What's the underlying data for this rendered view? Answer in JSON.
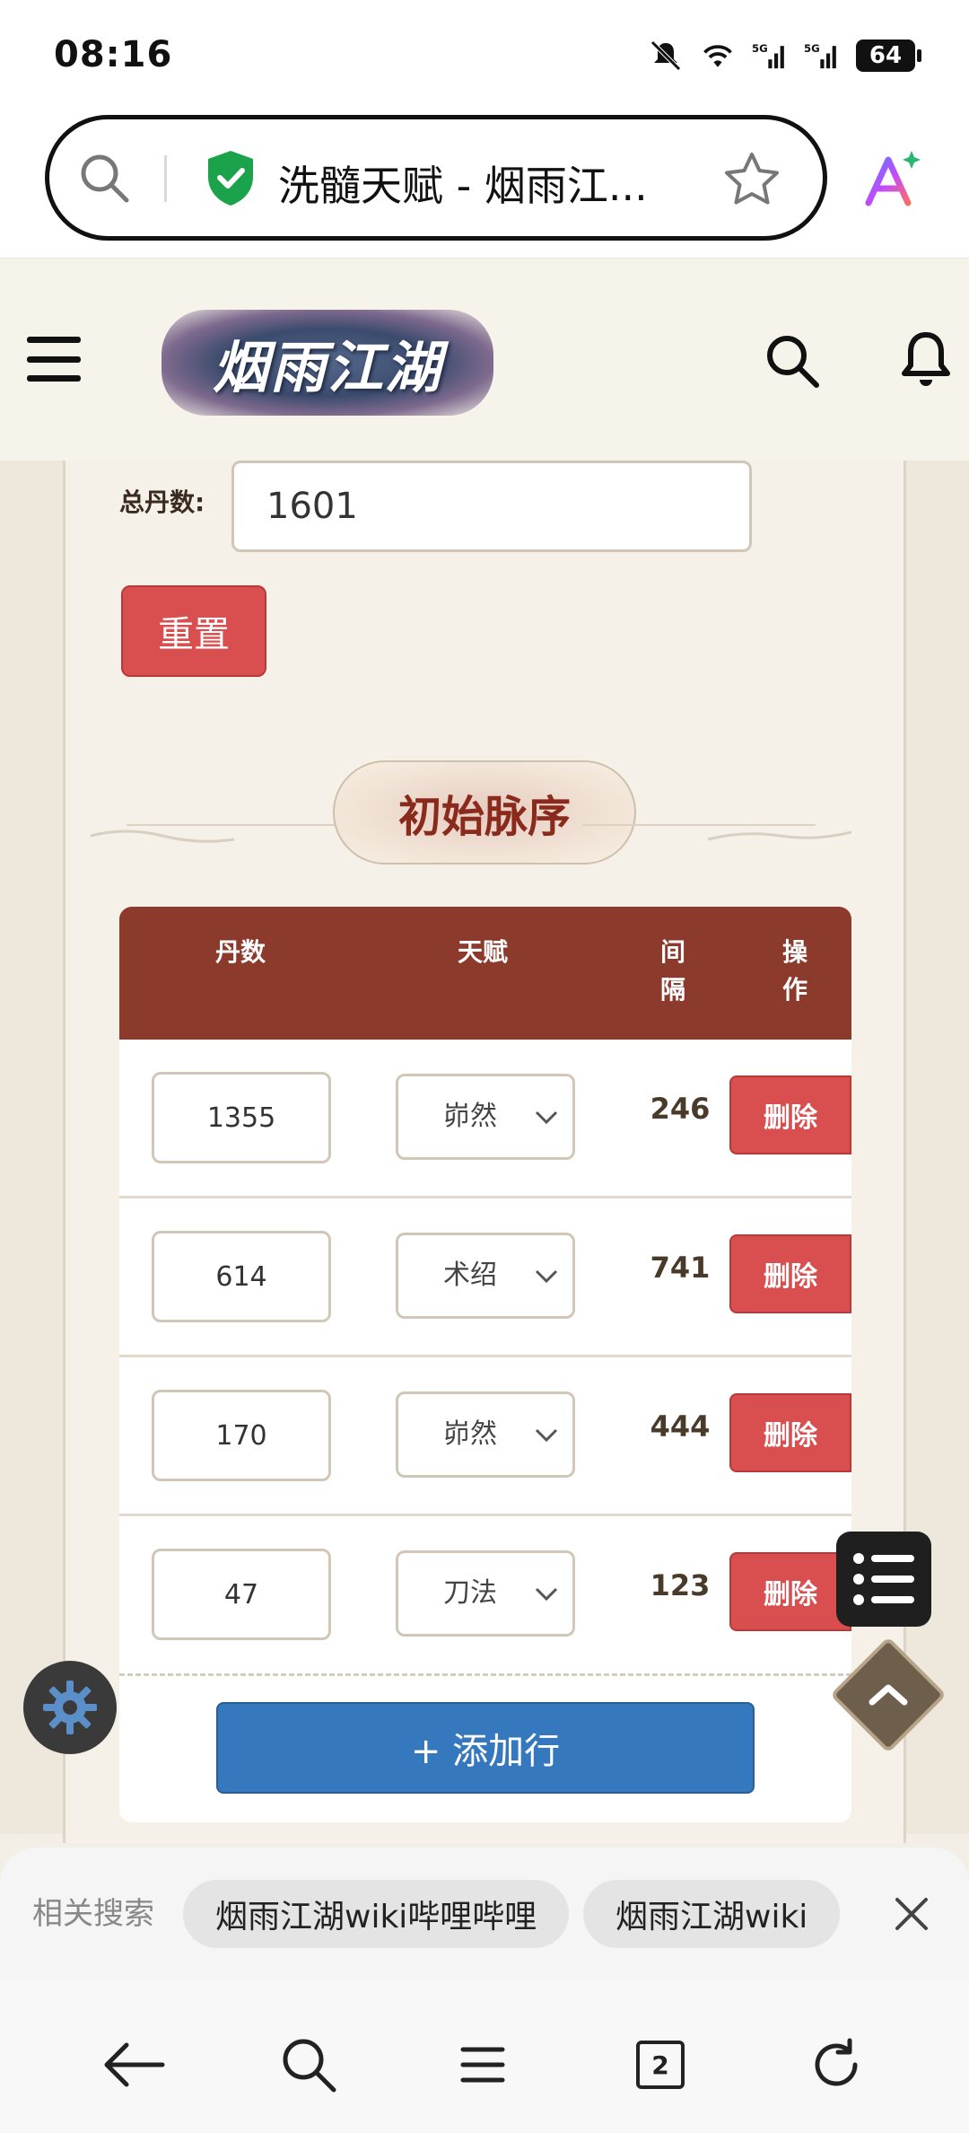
{
  "status_bar": {
    "time": "08:16",
    "battery": "64",
    "signal1": "5G",
    "signal2": "5G"
  },
  "browser": {
    "tab_title": "洗髓天赋 - 烟雨江..."
  },
  "site": {
    "logo_text": "烟雨江湖"
  },
  "form": {
    "total_label": "总丹数:",
    "total_value": "1601",
    "reset_label": "重置"
  },
  "section": {
    "title": "初始脉序"
  },
  "table": {
    "headers": {
      "dan": "丹数",
      "talent": "天赋",
      "gap_line1": "间",
      "gap_line2": "隔",
      "op_line1": "操",
      "op_line2": "作"
    },
    "rows": [
      {
        "dan": "1355",
        "talent": "峁然",
        "gap": "246",
        "delete": "删除"
      },
      {
        "dan": "614",
        "talent": "术绍",
        "gap": "741",
        "delete": "删除"
      },
      {
        "dan": "170",
        "talent": "峁然",
        "gap": "444",
        "delete": "删除"
      },
      {
        "dan": "47",
        "talent": "刀法",
        "gap": "123",
        "delete": "删除"
      }
    ],
    "add_row_label": "+ 添加行"
  },
  "related": {
    "label": "相关搜索",
    "chips": [
      "烟雨江湖wiki哔哩哔哩",
      "烟雨江湖wiki"
    ]
  },
  "nav": {
    "tab_count": "2"
  },
  "colors": {
    "accent_red": "#d94f4f",
    "header_brown": "#8c3a2c",
    "add_blue": "#3578bd"
  }
}
